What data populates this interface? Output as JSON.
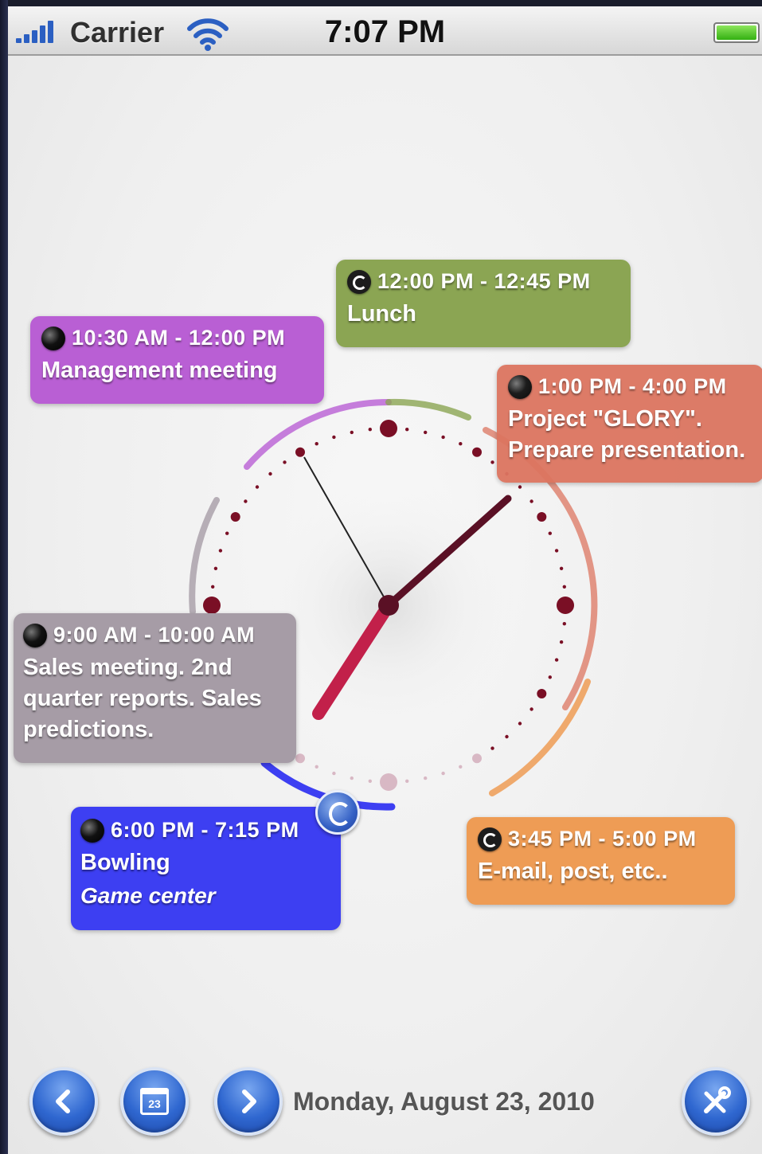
{
  "status_bar": {
    "carrier": "Carrier",
    "time": "7:07 PM",
    "icons": [
      "signal-bars-icon",
      "wifi-icon",
      "battery-icon"
    ]
  },
  "events": {
    "lunch": {
      "time": "12:00 PM - 12:45 PM",
      "title": "Lunch",
      "icon": "repeat-icon",
      "color": "#8ba553"
    },
    "management": {
      "time": "10:30 AM - 12:00 PM",
      "title": "Management meeting",
      "icon": "event-dot-icon",
      "color": "#b95fd4"
    },
    "glory": {
      "time": "1:00 PM - 4:00 PM",
      "title": "Project \"GLORY\".",
      "title2": "Prepare presentation.",
      "icon": "event-dot-icon",
      "color": "#dc7560"
    },
    "sales": {
      "time": "9:00 AM - 10:00 AM",
      "title": "Sales meeting. 2nd",
      "title2": "quarter reports. Sales",
      "title3": "predictions.",
      "icon": "event-dot-icon",
      "color": "#a69ca6"
    },
    "bowling": {
      "time": "6:00 PM - 7:15 PM",
      "title": "Bowling",
      "subtitle": "Game center",
      "icon": "event-dot-icon",
      "color": "#3d3ff2"
    },
    "email": {
      "time": "3:45 PM - 5:00 PM",
      "title": "E-mail, post, etc..",
      "icon": "repeat-icon",
      "color": "#ee9c55"
    }
  },
  "clock": {
    "hour": 7,
    "minute": 7,
    "hand_color": "#c2204a",
    "dot_color": "#7a0f25"
  },
  "toolbar": {
    "date": "Monday, August 23, 2010",
    "calendar_day": "23",
    "icons": [
      "chevron-left-icon",
      "calendar-icon",
      "chevron-right-icon",
      "tools-icon"
    ]
  }
}
